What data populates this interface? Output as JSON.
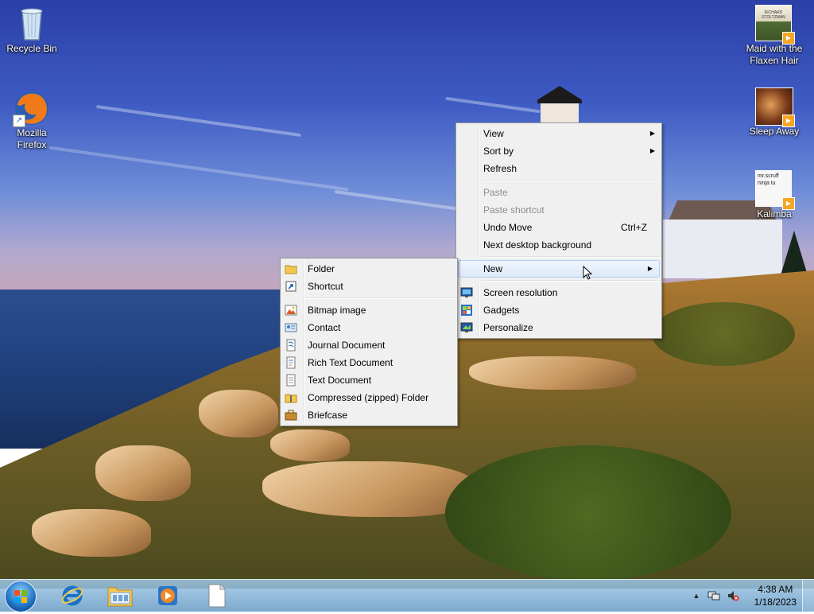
{
  "desktop": {
    "icons_left": [
      {
        "label": "Recycle Bin",
        "icon": "recycle-bin-icon"
      },
      {
        "label": "Mozilla Firefox",
        "icon": "firefox-icon"
      }
    ],
    "icons_right": [
      {
        "label": "Maid with the Flaxen Hair",
        "icon": "album-art-icon",
        "cover_text": "RICHARD STOLTZMAN"
      },
      {
        "label": "Sleep Away",
        "icon": "album-art-icon"
      },
      {
        "label": "Kalimba",
        "icon": "album-art-icon",
        "cover_text": "mr.scruff ninja tu"
      }
    ]
  },
  "context_menu": {
    "items": [
      {
        "label": "View",
        "submenu": true
      },
      {
        "label": "Sort by",
        "submenu": true
      },
      {
        "label": "Refresh"
      },
      {
        "label": "Paste",
        "disabled": true
      },
      {
        "label": "Paste shortcut",
        "disabled": true
      },
      {
        "label": "Undo Move",
        "accel": "Ctrl+Z"
      },
      {
        "label": "Next desktop background"
      },
      {
        "label": "New",
        "submenu": true,
        "highlighted": true
      },
      {
        "label": "Screen resolution",
        "icon": "screen-resolution-icon"
      },
      {
        "label": "Gadgets",
        "icon": "gadgets-icon"
      },
      {
        "label": "Personalize",
        "icon": "personalize-icon"
      }
    ]
  },
  "new_submenu": {
    "items": [
      {
        "label": "Folder",
        "icon": "folder-icon"
      },
      {
        "label": "Shortcut",
        "icon": "shortcut-icon"
      },
      {
        "label": "Bitmap image",
        "icon": "bitmap-icon"
      },
      {
        "label": "Contact",
        "icon": "contact-icon"
      },
      {
        "label": "Journal Document",
        "icon": "journal-icon"
      },
      {
        "label": "Rich Text Document",
        "icon": "rich-text-icon"
      },
      {
        "label": "Text Document",
        "icon": "text-document-icon"
      },
      {
        "label": "Compressed (zipped) Folder",
        "icon": "zip-folder-icon"
      },
      {
        "label": "Briefcase",
        "icon": "briefcase-icon"
      }
    ]
  },
  "taskbar": {
    "pinned": [
      {
        "icon": "internet-explorer-icon"
      },
      {
        "icon": "file-explorer-icon"
      },
      {
        "icon": "media-player-icon"
      },
      {
        "icon": "blank-document-icon"
      }
    ],
    "tray": {
      "show_hidden_glyph": "▲",
      "time": "4:38 AM",
      "date": "1/18/2023"
    }
  },
  "colors": {
    "menu_bg": "#f0f0f0",
    "menu_highlight": "#dce9f9",
    "taskbar": "#8fbad9"
  }
}
